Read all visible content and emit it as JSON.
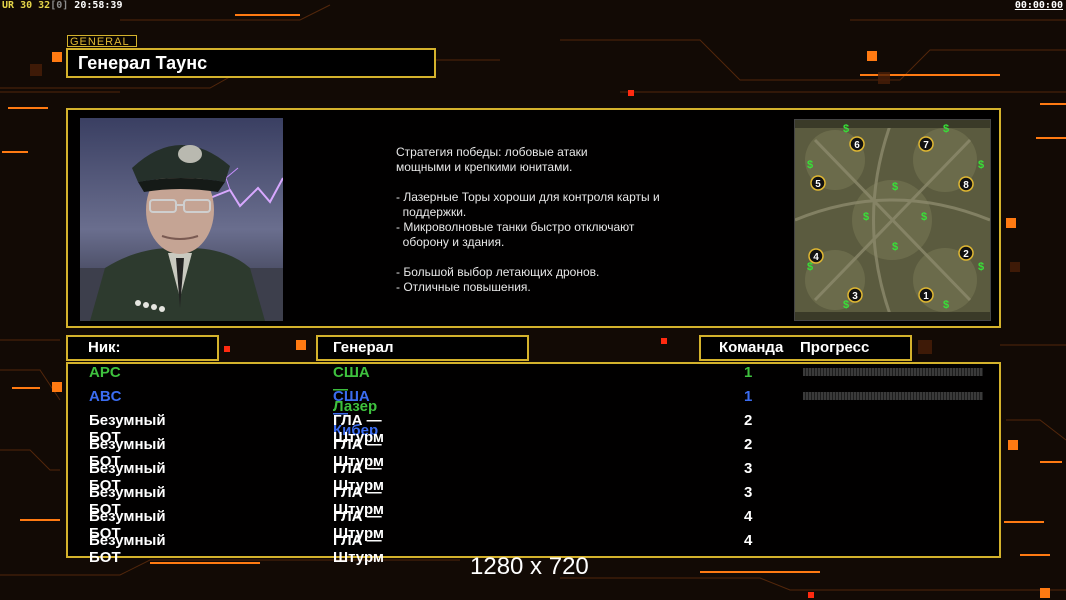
{
  "hud": {
    "ur": "UR",
    "n1": "30",
    "n2": "32",
    "bracket": "[0]",
    "time": "20:58:39",
    "timer": "00:00:00"
  },
  "general_tag": "GENERAL",
  "general_name": "Генерал Таунс",
  "description": [
    "Стратегия победы: лобовые атаки",
    "мощными и крепкими юнитами.",
    "",
    "- Лазерные Торы хороши для контроля карты и",
    "  поддержки.",
    "- Микроволновые танки быстро отключают",
    "  оборону и здания.",
    "",
    "- Большой выбор летающих дронов.",
    "- Отличные повышения."
  ],
  "headers": {
    "nick": "Ник:",
    "general": "Генерал",
    "team": "Команда",
    "progress": "Прогресс"
  },
  "players": [
    {
      "nick": "APC",
      "general": "США — Лазер",
      "team": "1",
      "color": "#3ec13e",
      "progress": true
    },
    {
      "nick": "ABC",
      "general": "США — Кибер",
      "team": "1",
      "color": "#3b6cf0",
      "progress": true
    },
    {
      "nick": "Безумный БОТ",
      "general": "ГЛА — Штурм",
      "team": "2",
      "color": "#ffffff",
      "progress": false
    },
    {
      "nick": "Безумный БОТ",
      "general": "ГЛА — Штурм",
      "team": "2",
      "color": "#ffffff",
      "progress": false
    },
    {
      "nick": "Безумный БОТ",
      "general": "ГЛА — Штурм",
      "team": "3",
      "color": "#ffffff",
      "progress": false
    },
    {
      "nick": "Безумный БОТ",
      "general": "ГЛА — Штурм",
      "team": "3",
      "color": "#ffffff",
      "progress": false
    },
    {
      "nick": "Безумный БОТ",
      "general": "ГЛА — Штурм",
      "team": "4",
      "color": "#ffffff",
      "progress": false
    },
    {
      "nick": "Безумный БОТ",
      "general": "ГЛА — Штурм",
      "team": "4",
      "color": "#ffffff",
      "progress": false
    }
  ],
  "map_start_labels": [
    "1",
    "2",
    "3",
    "4",
    "5",
    "6",
    "7",
    "8"
  ],
  "resolution": "1280 x 720",
  "colors": {
    "frame": "#d4b22c",
    "accent_orange": "#ff7a12",
    "background": "#120a05"
  }
}
